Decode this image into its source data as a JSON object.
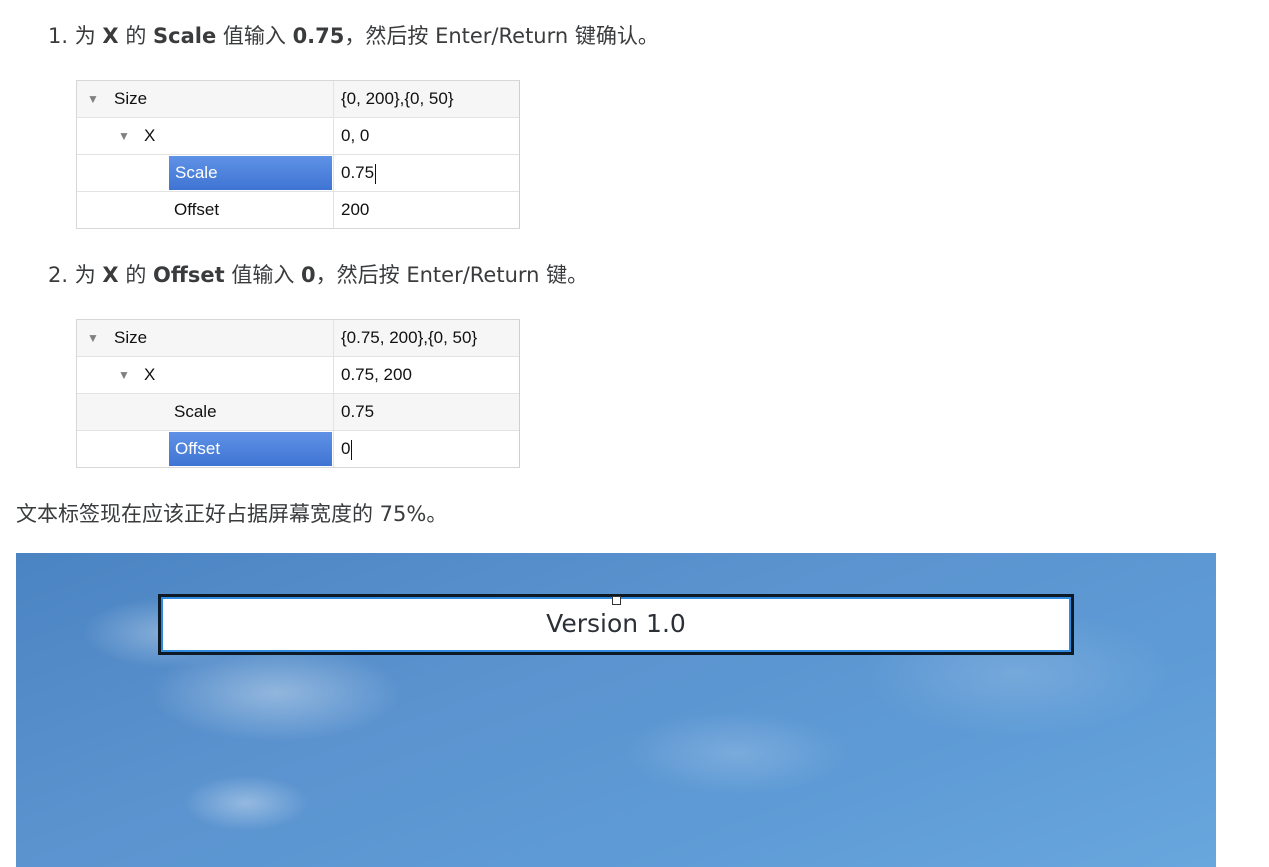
{
  "step1": {
    "num": "1.",
    "p1": "为",
    "b1": "X",
    "p2": "的",
    "b2": "Scale",
    "p3": "值输入",
    "b3": "0.75",
    "p4": "，然后按 Enter/Return 键确认。"
  },
  "table1": {
    "rows": [
      {
        "name": "Size",
        "value": "{0, 200},{0, 50}"
      },
      {
        "name": "X",
        "value": "0, 0"
      },
      {
        "name": "Scale",
        "value": "0.75"
      },
      {
        "name": "Offset",
        "value": "200"
      }
    ]
  },
  "step2": {
    "num": "2.",
    "p1": "为",
    "b1": "X",
    "p2": "的",
    "b2": "Offset",
    "p3": "值输入",
    "b3": "0",
    "p4": "，然后按 Enter/Return 键。"
  },
  "table2": {
    "rows": [
      {
        "name": "Size",
        "value": "{0.75, 200},{0, 50}"
      },
      {
        "name": "X",
        "value": "0.75, 200"
      },
      {
        "name": "Scale",
        "value": "0.75"
      },
      {
        "name": "Offset",
        "value": "0"
      }
    ]
  },
  "result_text": "文本标签现在应该正好占据屏幕宽度的 75%。",
  "preview": {
    "label_text": "Version 1.0"
  },
  "colors": {
    "selection": "#4a7fdc",
    "frame_border": "#0d1a26",
    "frame_inner": "#2f8ae0",
    "sky": "#5b93cf"
  }
}
